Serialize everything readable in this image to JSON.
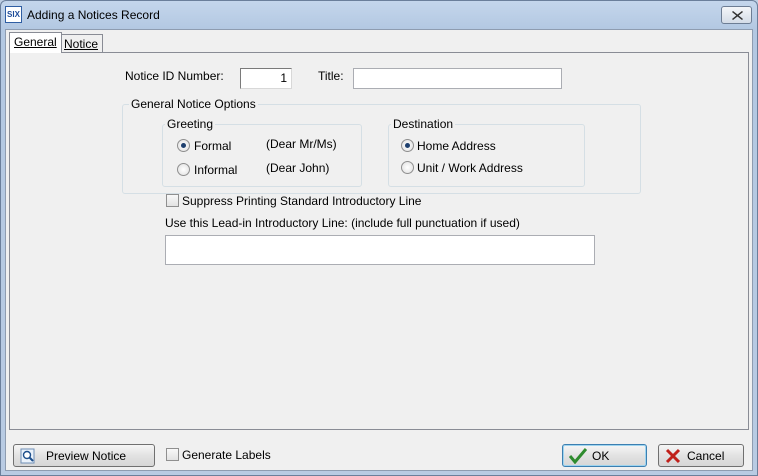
{
  "window": {
    "title": "Adding a Notices Record",
    "icon": "app-logo-icon"
  },
  "tabs": [
    {
      "label": "General"
    },
    {
      "label": "Notice"
    }
  ],
  "form": {
    "notice_id_label": "Notice ID Number:",
    "notice_id_value": "1",
    "title_label": "Title:",
    "title_value": "",
    "options_group": "General Notice Options",
    "greeting": {
      "title": "Greeting",
      "formal_label": "Formal",
      "formal_example": "(Dear Mr/Ms)",
      "informal_label": "Informal",
      "informal_example": "(Dear John)",
      "selected": "Formal"
    },
    "destination": {
      "title": "Destination",
      "home_label": "Home Address",
      "work_label": "Unit / Work Address",
      "selected": "Home Address"
    },
    "suppress_label": "Suppress Printing Standard Introductory Line",
    "suppress_checked": false,
    "leadin_label": "Use this Lead-in Introductory Line:  (include full punctuation if used)",
    "leadin_value": ""
  },
  "footer": {
    "preview_label": "Preview Notice",
    "generate_labels_label": "Generate Labels",
    "generate_labels_checked": false,
    "ok_label": "OK",
    "cancel_label": "Cancel"
  },
  "colors": {
    "ok_check": "#2e8b2e",
    "cancel_x": "#c0201a",
    "titlebar": "#b9cbe3"
  }
}
